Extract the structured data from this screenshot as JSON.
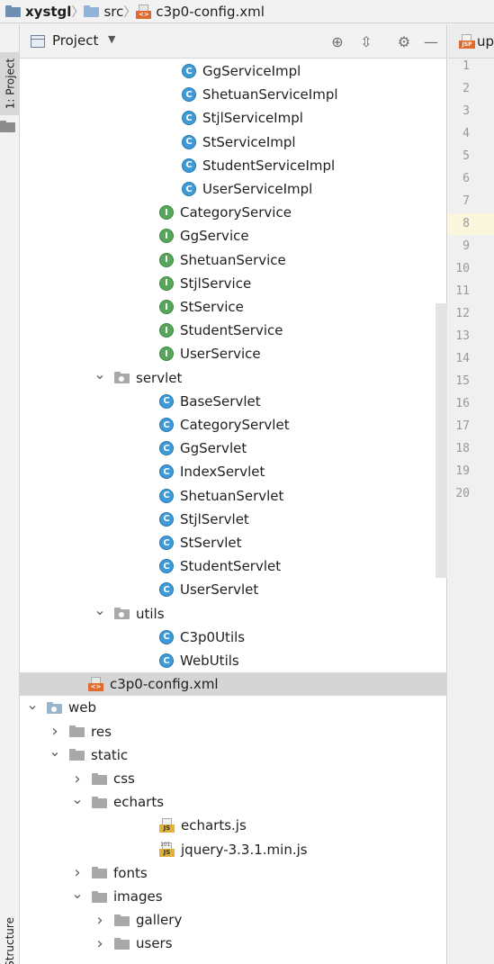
{
  "breadcrumb": [
    {
      "label": "xystgl",
      "icon": "project-folder-icon",
      "bold": true
    },
    {
      "label": "src",
      "icon": "source-folder-icon",
      "bold": false
    },
    {
      "label": "c3p0-config.xml",
      "icon": "xml-file-icon",
      "bold": false
    }
  ],
  "left_strip": {
    "project_tab": "1: Project",
    "structure_tab": "Z: Structure"
  },
  "panel": {
    "title": "Project",
    "buttons": [
      "locate-icon",
      "collapse-icon",
      "settings-gear-icon",
      "hide-icon"
    ]
  },
  "tree": [
    {
      "label": "GgServiceImpl",
      "icon": "class",
      "indent": 2
    },
    {
      "label": "ShetuanServiceImpl",
      "icon": "class",
      "indent": 2
    },
    {
      "label": "StjlServiceImpl",
      "icon": "class",
      "indent": 2
    },
    {
      "label": "StServiceImpl",
      "icon": "class",
      "indent": 2
    },
    {
      "label": "StudentServiceImpl",
      "icon": "class",
      "indent": 2
    },
    {
      "label": "UserServiceImpl",
      "icon": "class",
      "indent": 2
    },
    {
      "label": "CategoryService",
      "icon": "interface",
      "indent": 1
    },
    {
      "label": "GgService",
      "icon": "interface",
      "indent": 1
    },
    {
      "label": "ShetuanService",
      "icon": "interface",
      "indent": 1
    },
    {
      "label": "StjlService",
      "icon": "interface",
      "indent": 1
    },
    {
      "label": "StService",
      "icon": "interface",
      "indent": 1
    },
    {
      "label": "StudentService",
      "icon": "interface",
      "indent": 1
    },
    {
      "label": "UserService",
      "icon": "interface",
      "indent": 1
    },
    {
      "label": "servlet",
      "icon": "package",
      "indent": 0,
      "expanded": true
    },
    {
      "label": "BaseServlet",
      "icon": "class",
      "indent": 1
    },
    {
      "label": "CategoryServlet",
      "icon": "class",
      "indent": 1
    },
    {
      "label": "GgServlet",
      "icon": "class",
      "indent": 1
    },
    {
      "label": "IndexServlet",
      "icon": "class",
      "indent": 1
    },
    {
      "label": "ShetuanServlet",
      "icon": "class",
      "indent": 1
    },
    {
      "label": "StjlServlet",
      "icon": "class",
      "indent": 1
    },
    {
      "label": "StServlet",
      "icon": "class",
      "indent": 1
    },
    {
      "label": "StudentServlet",
      "icon": "class",
      "indent": 1
    },
    {
      "label": "UserServlet",
      "icon": "class",
      "indent": 1
    },
    {
      "label": "utils",
      "icon": "package",
      "indent": 0,
      "expanded": true
    },
    {
      "label": "C3p0Utils",
      "icon": "class",
      "indent": 1
    },
    {
      "label": "WebUtils",
      "icon": "class",
      "indent": 1
    },
    {
      "label": "c3p0-config.xml",
      "icon": "xml",
      "indent": -1,
      "selected": true
    },
    {
      "label": "web",
      "icon": "web-folder",
      "indent": -3,
      "expanded": true
    },
    {
      "label": "res",
      "icon": "folder",
      "indent": -2,
      "expanded": false
    },
    {
      "label": "static",
      "icon": "folder",
      "indent": -2,
      "expanded": true
    },
    {
      "label": "css",
      "icon": "folder",
      "indent": -1,
      "expanded": false
    },
    {
      "label": "echarts",
      "icon": "folder",
      "indent": -1,
      "expanded": true
    },
    {
      "label": "echarts.js",
      "icon": "js",
      "indent": 1
    },
    {
      "label": "jquery-3.3.1.min.js",
      "icon": "js-min",
      "indent": 1
    },
    {
      "label": "fonts",
      "icon": "folder",
      "indent": -1,
      "expanded": false
    },
    {
      "label": "images",
      "icon": "folder",
      "indent": -1,
      "expanded": true
    },
    {
      "label": "gallery",
      "icon": "folder",
      "indent": 0,
      "expanded": false
    },
    {
      "label": "users",
      "icon": "folder",
      "indent": 0,
      "expanded": false
    }
  ],
  "editor": {
    "tab_label": "up",
    "highlight_line": 8,
    "line_numbers": [
      "1",
      "2",
      "3",
      "4",
      "5",
      "6",
      "7",
      "8",
      "9",
      "10",
      "11",
      "12",
      "13",
      "14",
      "15",
      "16",
      "17",
      "18",
      "19",
      "20"
    ]
  }
}
